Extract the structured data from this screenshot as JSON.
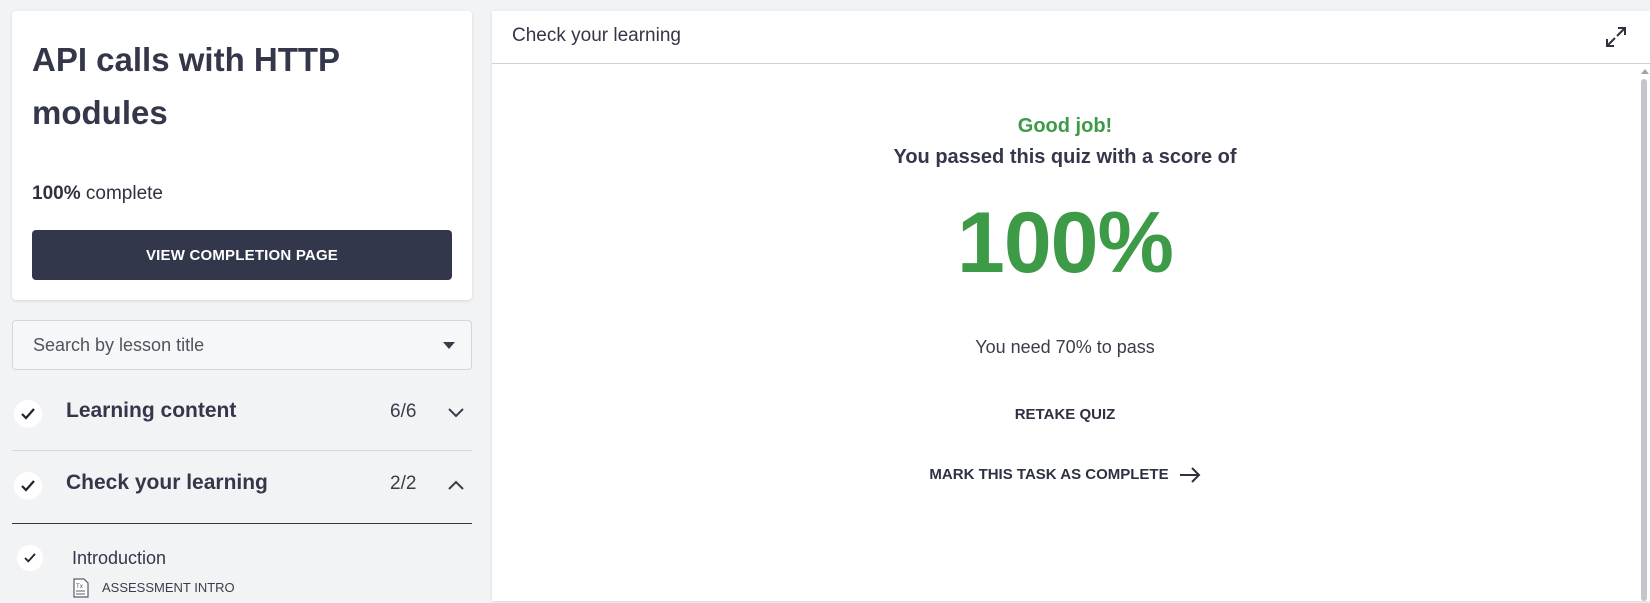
{
  "sidebar": {
    "course_title": "API calls with HTTP modules",
    "progress_value": "100%",
    "progress_suffix": "complete",
    "view_completion_label": "VIEW COMPLETION PAGE",
    "search_placeholder": "Search by lesson title",
    "sections": [
      {
        "label": "Learning content",
        "count": "6/6",
        "expanded": false,
        "completed": true
      },
      {
        "label": "Check your learning",
        "count": "2/2",
        "expanded": true,
        "completed": true
      }
    ],
    "lessons": [
      {
        "title": "Introduction",
        "type": "ASSESSMENT INTRO",
        "completed": true
      }
    ]
  },
  "main": {
    "header_title": "Check your learning",
    "expand_icon": "expand-icon",
    "result_heading": "Good job!",
    "result_text": "You passed this quiz with a score of",
    "score": "100%",
    "pass_requirement": "You need 70% to pass",
    "retake_label": "RETAKE QUIZ",
    "mark_complete_label": "MARK THIS TASK AS COMPLETE",
    "mark_complete_icon": "arrow-right-icon"
  },
  "colors": {
    "accent_green": "#3d9a46",
    "primary_button": "#33374b",
    "sidebar_bg": "#f2f3f5"
  }
}
